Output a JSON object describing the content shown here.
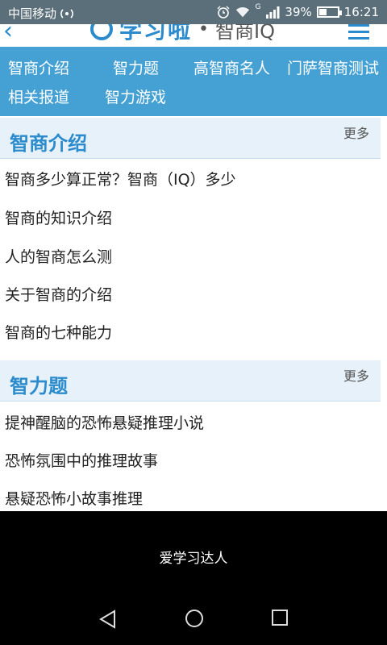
{
  "status_bar": {
    "carrier": "中国移动",
    "network_type": "G",
    "battery_percent": "39%",
    "battery_level": 0.39,
    "time": "16:21"
  },
  "app_header": {
    "logo_text": "学习啦",
    "separator": "•",
    "subtitle": "智商IQ"
  },
  "nav": {
    "categories": [
      "智商介绍",
      "智力题",
      "高智商名人",
      "门萨智商测试",
      "相关报道",
      "智力游戏"
    ]
  },
  "sections": [
    {
      "title": "智商介绍",
      "more": "更多",
      "items": [
        "智商多少算正常？智商（IQ）多少",
        "智商的知识介绍",
        "人的智商怎么测",
        "关于智商的介绍",
        "智商的七种能力"
      ]
    },
    {
      "title": "智力题",
      "more": "更多",
      "items": [
        "提神醒脑的恐怖悬疑推理小说",
        "恐怖氛围中的推理故事",
        "悬疑恐怖小故事推理"
      ]
    }
  ],
  "footer": {
    "text": "爱学习达人"
  }
}
